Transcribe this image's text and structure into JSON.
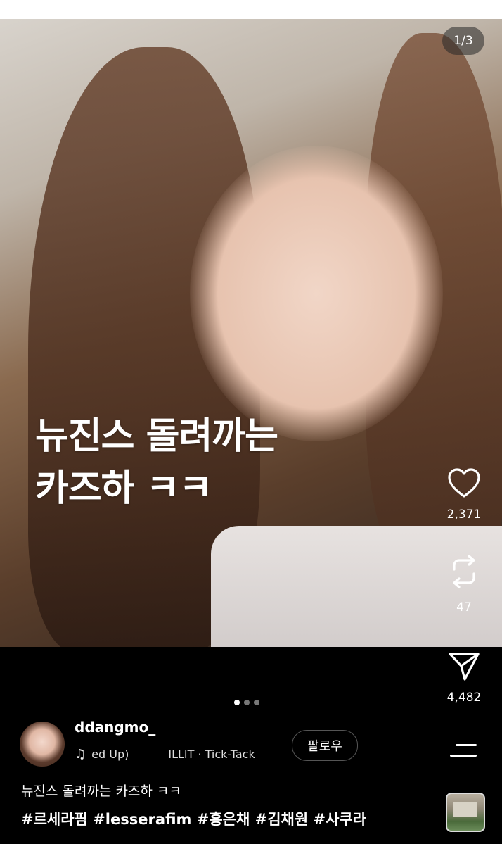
{
  "post": {
    "image_counter": "1/3",
    "overlay_text_line1": "뉴진스 돌려까는",
    "overlay_text_line2": "카즈하 ㅋㅋ",
    "carousel": {
      "total": 3,
      "active_index": 0
    }
  },
  "actions": {
    "likes": "2,371",
    "reposts": "47",
    "shares": "4,482"
  },
  "author": {
    "username": "ddangmo_",
    "follow_label": "팔로우",
    "music_part1": "ed Up)",
    "music_part2": "ILLIT · Tick-Tack"
  },
  "caption": {
    "text": "뉴진스 돌려까는 카즈하 ㅋㅋ",
    "hashtags": "#르세라핌 #lesserafim #홍은채 #김채원 #사쿠라"
  },
  "icons": {
    "like": "heart-icon",
    "repost": "repost-icon",
    "share": "send-icon",
    "menu": "menu-icon",
    "music": "music-note-icon"
  }
}
